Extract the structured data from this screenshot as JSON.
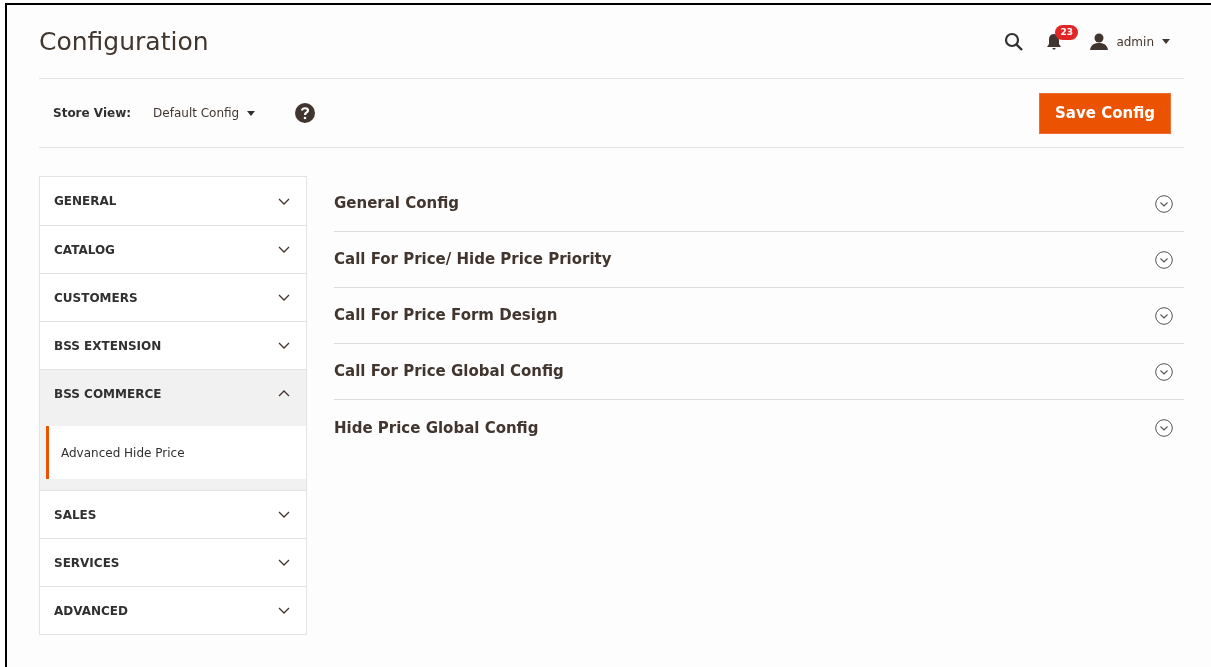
{
  "page_title": "Configuration",
  "header": {
    "notifications_count": "23",
    "user": "admin"
  },
  "store_view": {
    "label": "Store View:",
    "value": "Default Config"
  },
  "save_button": "Save Config",
  "sidebar": {
    "items": [
      {
        "label": "GENERAL",
        "expanded": false
      },
      {
        "label": "CATALOG",
        "expanded": false
      },
      {
        "label": "CUSTOMERS",
        "expanded": false
      },
      {
        "label": "BSS EXTENSION",
        "expanded": false
      },
      {
        "label": "BSS COMMERCE",
        "expanded": true,
        "children": [
          {
            "label": "Advanced Hide Price",
            "selected": true
          }
        ]
      },
      {
        "label": "SALES",
        "expanded": false
      },
      {
        "label": "SERVICES",
        "expanded": false
      },
      {
        "label": "ADVANCED",
        "expanded": false
      }
    ]
  },
  "sections": [
    {
      "title": "General Config"
    },
    {
      "title": "Call For Price/ Hide Price Priority"
    },
    {
      "title": "Call For Price Form Design"
    },
    {
      "title": "Call For Price Global Config"
    },
    {
      "title": "Hide Price Global Config"
    }
  ]
}
